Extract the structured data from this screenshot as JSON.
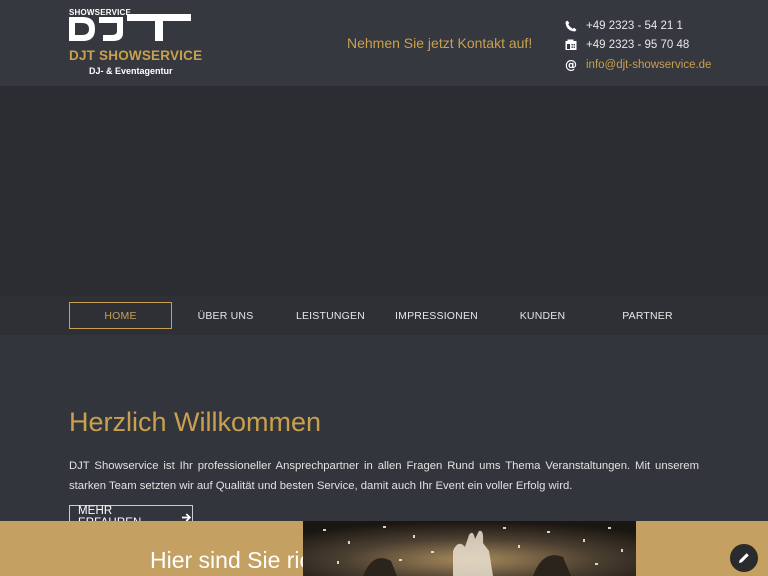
{
  "brand": {
    "logo_small": "SHOWSERVICE",
    "logo_letters": "DJT",
    "name": "DJT SHOWSERVICE",
    "subtitle": "DJ- & Eventagentur"
  },
  "header": {
    "tagline": "Nehmen Sie jetzt Kontakt auf!",
    "contacts": [
      {
        "icon": "phone-icon",
        "value": "+49 2323 - 54 21 1"
      },
      {
        "icon": "fax-icon",
        "value": "+49 2323 - 95 70 48"
      },
      {
        "icon": "at-icon",
        "value": "info@djt-showservice.de"
      }
    ]
  },
  "nav": {
    "items": [
      {
        "label": "HOME",
        "active": true
      },
      {
        "label": "ÜBER UNS",
        "active": false
      },
      {
        "label": "LEISTUNGEN",
        "active": false
      },
      {
        "label": "IMPRESSIONEN",
        "active": false
      },
      {
        "label": "KUNDEN",
        "active": false
      },
      {
        "label": "PARTNER",
        "active": false
      }
    ]
  },
  "main": {
    "heading": "Herzlich Willkommen",
    "intro": "DJT Showservice ist Ihr professioneller Ansprechpartner in allen Fragen Rund ums Thema Veranstaltungen. Mit unserem starken Team setzten wir auf Qualität und besten Service, damit auch Ihr Event ein voller Erfolg wird.",
    "more_label": "MEHR ERFAHREN"
  },
  "bottom": {
    "title": "Hier sind Sie rich"
  },
  "colors": {
    "accent": "#c9a04e",
    "header_bg": "#35383e",
    "page_bg": "#2b2d33",
    "bottom_bg": "#c4a062"
  }
}
